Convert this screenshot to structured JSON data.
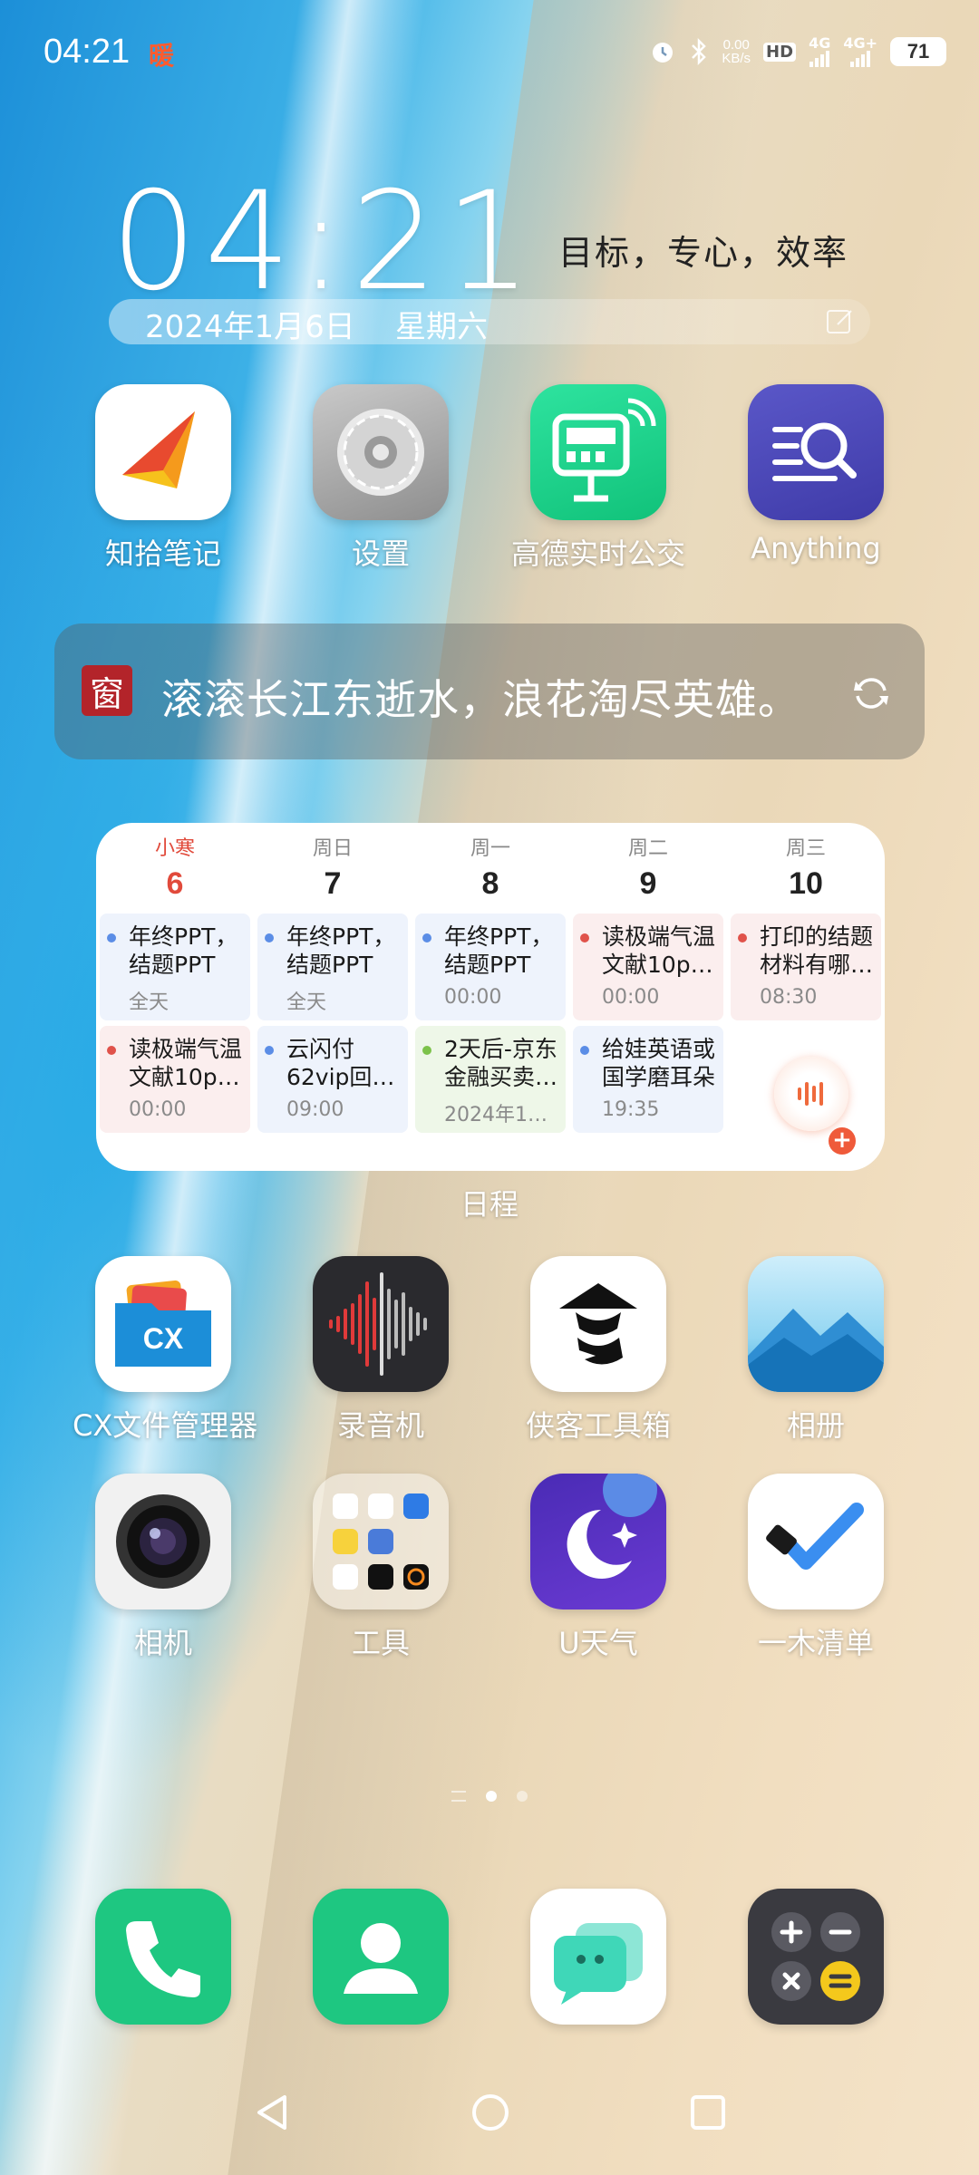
{
  "status_bar": {
    "time": "04:21",
    "app_indicator": "暖",
    "speed_top": "0.00",
    "speed_bottom": "KB/s",
    "hd_label": "HD",
    "sim1_label": "4G",
    "sim2_label": "4G+",
    "battery": "71"
  },
  "clock_widget": {
    "time": "04:21",
    "motto": "目标，专心，效率",
    "date": "2024年1月6日",
    "weekday": "星期六"
  },
  "apps_row1": [
    {
      "label": "知拾笔记",
      "icon": "zhishi-notes-icon"
    },
    {
      "label": "设置",
      "icon": "settings-gear-icon"
    },
    {
      "label": "高德实时公交",
      "icon": "amap-bus-icon"
    },
    {
      "label": "Anything",
      "icon": "anything-search-icon"
    }
  ],
  "poem_widget": {
    "seal": "窗",
    "text": "滚滚长江东逝水，浪花淘尽英雄。"
  },
  "calendar": {
    "label": "日程",
    "days": [
      {
        "weekday": "小寒",
        "day": "6"
      },
      {
        "weekday": "周日",
        "day": "7"
      },
      {
        "weekday": "周一",
        "day": "8"
      },
      {
        "weekday": "周二",
        "day": "9"
      },
      {
        "weekday": "周三",
        "day": "10"
      }
    ],
    "events_row1": [
      {
        "title": "年终PPT，结题PPT",
        "sub": "全天",
        "color": "blue"
      },
      {
        "title": "年终PPT，结题PPT",
        "sub": "全天",
        "color": "blue"
      },
      {
        "title": "年终PPT，结题PPT",
        "sub": "00:00",
        "color": "blue"
      },
      {
        "title": "读极端气温文献10p…",
        "sub": "00:00",
        "color": "red"
      },
      {
        "title": "打印的结题材料有哪…",
        "sub": "08:30",
        "color": "red"
      }
    ],
    "events_row2": [
      {
        "title": "读极端气温文献10p…",
        "sub": "00:00",
        "color": "red"
      },
      {
        "title": "云闪付62vip回…",
        "sub": "09:00",
        "color": "blue"
      },
      {
        "title": "2天后-京东金融买卖…",
        "sub": "2024年1…",
        "color": "green"
      },
      {
        "title": "给娃英语或国学磨耳朵",
        "sub": "19:35",
        "color": "blue"
      }
    ]
  },
  "apps_row2": [
    {
      "label": "CX文件管理器",
      "icon": "cx-file-manager-icon"
    },
    {
      "label": "录音机",
      "icon": "recorder-icon"
    },
    {
      "label": "侠客工具箱",
      "icon": "xiake-toolbox-icon"
    },
    {
      "label": "相册",
      "icon": "gallery-icon"
    }
  ],
  "apps_row3": [
    {
      "label": "相机",
      "icon": "camera-icon"
    },
    {
      "label": "工具",
      "icon": "tools-folder-icon"
    },
    {
      "label": "U天气",
      "icon": "u-weather-icon"
    },
    {
      "label": "一木清单",
      "icon": "yimu-checklist-icon"
    }
  ],
  "dock": [
    {
      "icon": "phone-icon"
    },
    {
      "icon": "contacts-icon"
    },
    {
      "icon": "messages-icon"
    },
    {
      "icon": "calculator-icon"
    }
  ],
  "colors": {
    "accent_green": "#1ec781",
    "calendar_red": "#e14a3b",
    "poem_seal": "#b3242a"
  }
}
